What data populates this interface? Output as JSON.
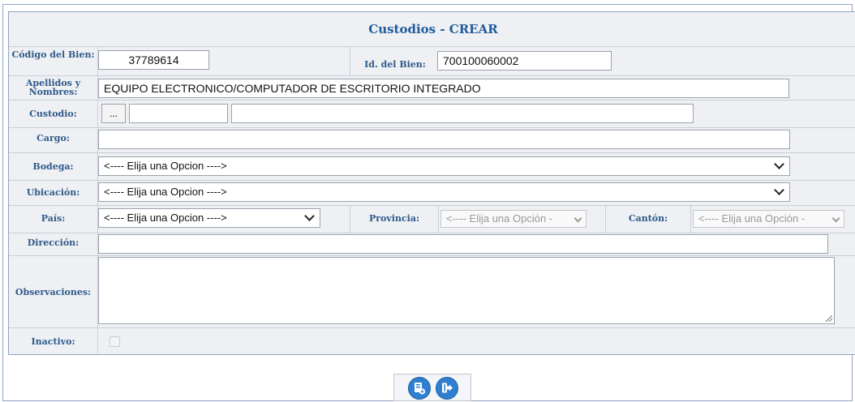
{
  "form": {
    "title": "Custodios   - CREAR",
    "codigo_label": "Código del Bien:",
    "codigo_value": "37789614",
    "id_label": "Id. del Bien:",
    "id_value": "700100060002",
    "apellidos_label": "Apellidos y Nombres:",
    "apellidos_value": "EQUIPO ELECTRONICO/COMPUTADOR DE ESCRITORIO INTEGRADO",
    "custodio_label": "Custodio:",
    "custodio_button": "...",
    "custodio_code": "",
    "custodio_name": "",
    "cargo_label": "Cargo:",
    "cargo_value": "",
    "bodega_label": "Bodega:",
    "bodega_value": "<---- Elija una Opcion ---->",
    "ubicacion_label": "Ubicación:",
    "ubicacion_value": "<---- Elija una Opcion ---->",
    "pais_label": "País:",
    "pais_value": "<---- Elija una Opcion ---->",
    "provincia_label": "Provincia:",
    "provincia_value": "<---- Elija una Opción -",
    "canton_label": "Cantón:",
    "canton_value": "<---- Elija una Opción -",
    "direccion_label": "Dirección:",
    "direccion_value": "",
    "observaciones_label": "Observaciones:",
    "observaciones_value": "",
    "inactivo_label": "Inactivo:",
    "inactivo_checked": false
  },
  "actions": {
    "save_icon": "save-add-icon",
    "exit_icon": "exit-icon"
  },
  "colors": {
    "title": "#1e5c9a",
    "label": "#2f5a8a",
    "panel_bg": "#eef0f3",
    "button": "#2f7fd0"
  }
}
